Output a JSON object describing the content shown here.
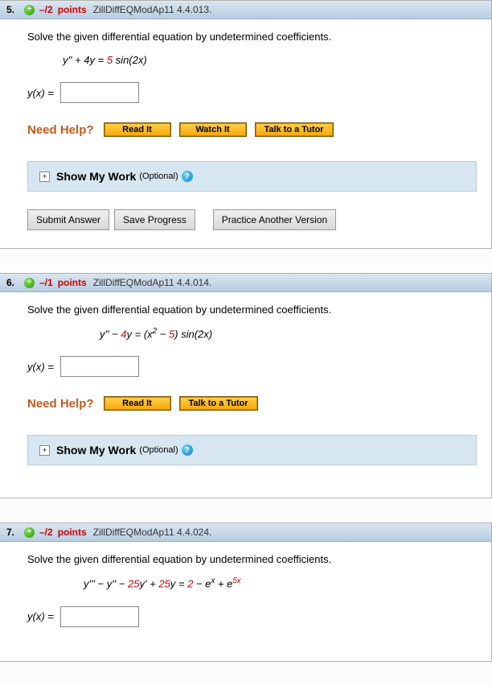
{
  "questions": [
    {
      "number": "5.",
      "points": "–/2",
      "points_word": "points",
      "source": "ZillDiffEQModAp11 4.4.013.",
      "prompt": "Solve the given differential equation by undetermined coefficients.",
      "answer_label": "y(x) =",
      "help": {
        "label": "Need Help?",
        "read": "Read It",
        "watch": "Watch It",
        "tutor": "Talk to a Tutor"
      },
      "showwork": {
        "label": "Show My Work",
        "opt": "(Optional)"
      },
      "buttons": {
        "submit": "Submit Answer",
        "save": "Save Progress",
        "practice": "Practice Another Version"
      }
    },
    {
      "number": "6.",
      "points": "–/1",
      "points_word": "points",
      "source": "ZillDiffEQModAp11 4.4.014.",
      "prompt": "Solve the given differential equation by undetermined coefficients.",
      "answer_label": "y(x) =",
      "help": {
        "label": "Need Help?",
        "read": "Read It",
        "tutor": "Talk to a Tutor"
      },
      "showwork": {
        "label": "Show My Work",
        "opt": "(Optional)"
      }
    },
    {
      "number": "7.",
      "points": "–/2",
      "points_word": "points",
      "source": "ZillDiffEQModAp11 4.4.024.",
      "prompt": "Solve the given differential equation by undetermined coefficients.",
      "answer_label": "y(x) ="
    }
  ],
  "equations": {
    "q5": {
      "coef": "5"
    },
    "q6": {
      "coef": "4",
      "const": "5"
    },
    "q7": {
      "a": "25",
      "b": "25",
      "c": "2",
      "exp": "5"
    }
  }
}
